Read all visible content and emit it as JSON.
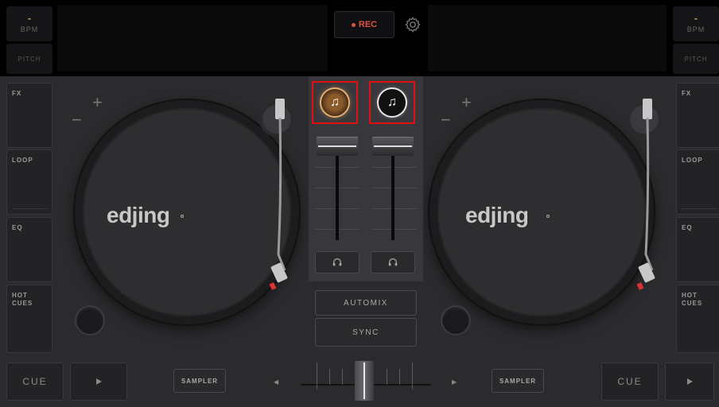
{
  "top": {
    "left_bpm": {
      "value": "-",
      "label": "BPM"
    },
    "left_pitch": "PITCH",
    "right_bpm": {
      "value": "-",
      "label": "BPM"
    },
    "right_pitch": "PITCH",
    "rec_label": "REC",
    "settings_icon": "gear-icon"
  },
  "left_side": [
    {
      "label": "FX"
    },
    {
      "label": "LOOP"
    },
    {
      "label": "EQ"
    },
    {
      "label": "HOT\nCUES"
    }
  ],
  "right_side": [
    {
      "label": "FX"
    },
    {
      "label": "LOOP"
    },
    {
      "label": "EQ"
    },
    {
      "label": "HOT\nCUES"
    }
  ],
  "deck_left": {
    "logo": "edjing",
    "plus": "+",
    "minus": "−"
  },
  "deck_right": {
    "logo": "edjing",
    "plus": "+",
    "minus": "−"
  },
  "mixer": {
    "load_left_icon": "music-note-icon",
    "load_right_icon": "music-note-icon",
    "headphone_left_icon": "headphone-icon",
    "headphone_right_icon": "headphone-icon",
    "automix_label": "AUTOMIX",
    "sync_label": "SYNC"
  },
  "bottom": {
    "left_cue": "CUE",
    "left_play_icon": "play-icon",
    "left_sampler": "SAMPLER",
    "right_sampler": "SAMPLER",
    "right_cue": "CUE",
    "right_play_icon": "play-icon"
  },
  "colors": {
    "rec_red": "#e0523e",
    "highlight_red": "#e01010",
    "left_deck_accent": "#e8b070",
    "right_deck_accent": "#e8e8e8"
  }
}
